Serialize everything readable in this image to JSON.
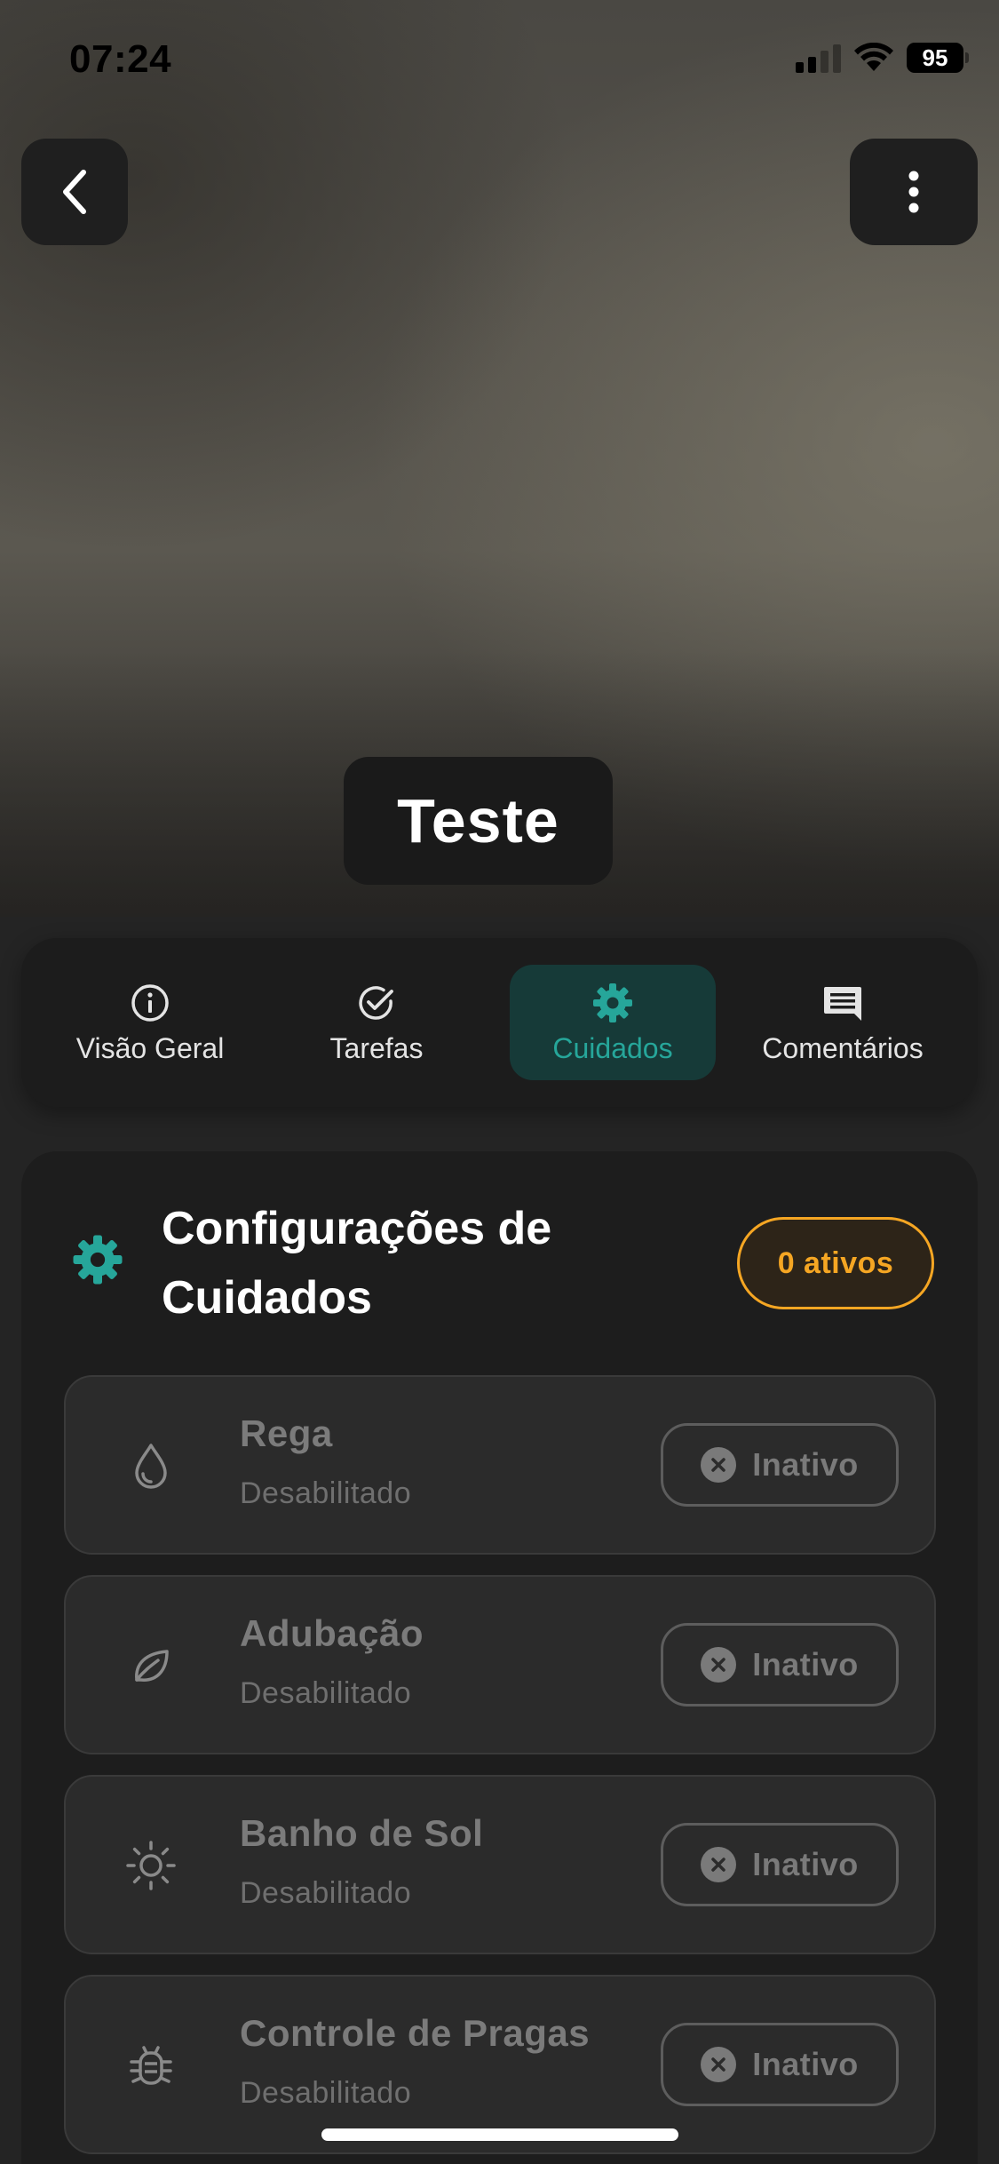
{
  "status_bar": {
    "time": "07:24",
    "battery": "95"
  },
  "header": {
    "back_icon": "chevron-left-icon",
    "more_icon": "more-vertical-icon"
  },
  "plant": {
    "name": "Teste"
  },
  "tabs": [
    {
      "label": "Visão Geral",
      "icon": "info-icon",
      "active": false
    },
    {
      "label": "Tarefas",
      "icon": "check-circle-icon",
      "active": false
    },
    {
      "label": "Cuidados",
      "icon": "gear-icon",
      "active": true
    },
    {
      "label": "Comentários",
      "icon": "comment-icon",
      "active": false
    }
  ],
  "care_card": {
    "title": "Configurações de Cuidados",
    "active_count": "0 ativos",
    "items": [
      {
        "name": "Rega",
        "status": "Desabilitado",
        "toggle": "Inativo",
        "icon": "water-drop-icon"
      },
      {
        "name": "Adubação",
        "status": "Desabilitado",
        "toggle": "Inativo",
        "icon": "leaf-icon"
      },
      {
        "name": "Banho de Sol",
        "status": "Desabilitado",
        "toggle": "Inativo",
        "icon": "sun-icon"
      },
      {
        "name": "Controle de Pragas",
        "status": "Desabilitado",
        "toggle": "Inativo",
        "icon": "bug-icon"
      }
    ]
  },
  "colors": {
    "accent": "#26a69a",
    "warning": "#f5a623",
    "background": "#242424"
  }
}
